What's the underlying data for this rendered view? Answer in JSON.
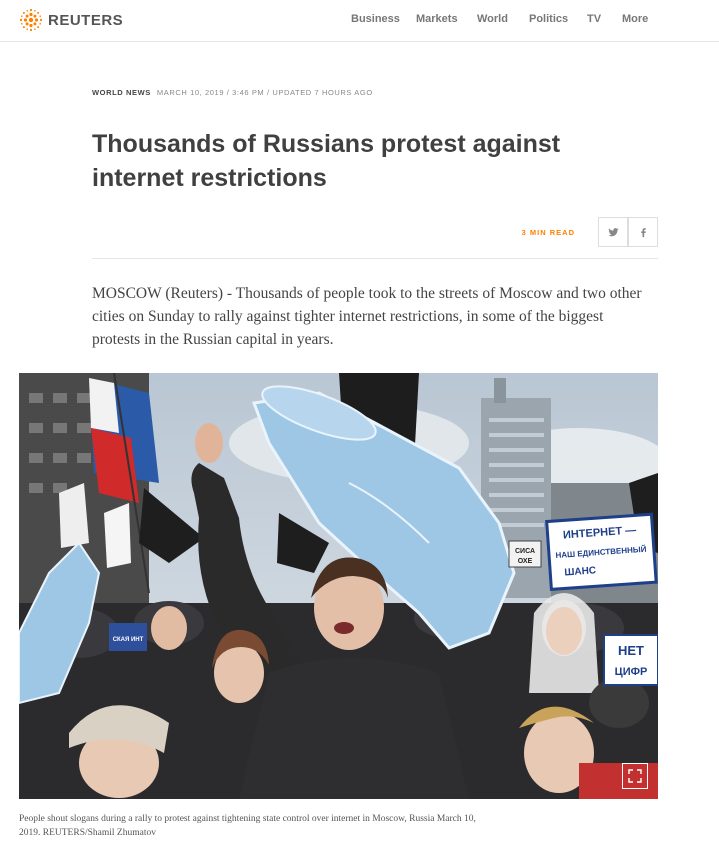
{
  "header": {
    "logo_text": "REUTERS",
    "nav": [
      {
        "label": "Business",
        "name": "nav-business"
      },
      {
        "label": "Markets",
        "name": "nav-markets"
      },
      {
        "label": "World",
        "name": "nav-world"
      },
      {
        "label": "Politics",
        "name": "nav-politics"
      },
      {
        "label": "TV",
        "name": "nav-tv"
      },
      {
        "label": "More",
        "name": "nav-more"
      }
    ]
  },
  "article": {
    "section": "WORLD NEWS",
    "dateline": "MARCH 10, 2019 / 3:46 PM / UPDATED 7 HOURS AGO",
    "title": "Thousands of Russians protest against internet restrictions",
    "read_time": "3 MIN READ",
    "share": {
      "twitter_icon": "twitter-icon",
      "facebook_icon": "facebook-icon"
    },
    "lead": "MOSCOW (Reuters) - Thousands of people took to the streets of Moscow and two other cities on Sunday to rally against tighter internet restrictions, in some of the biggest protests in the Russian capital in years.",
    "photo": {
      "sign_line1": "ИНТЕРНЕТ —",
      "sign_line2": "НАШ ЕДИНСТВЕННЫЙ",
      "sign_line3": "ШАНС",
      "sign_right": "НЕТ",
      "sign_right2": "ЦИФР",
      "sign_small": "СКАЯ ИНТ",
      "sign_small2": "СИСА",
      "sign_small3": "ОХЕ"
    },
    "caption": "People shout slogans during a rally to protest against tightening state control over internet in Moscow, Russia March 10, 2019. REUTERS/Shamil Zhumatov"
  },
  "colors": {
    "accent": "#ff8000",
    "text": "#404040",
    "nav": "#777777"
  }
}
